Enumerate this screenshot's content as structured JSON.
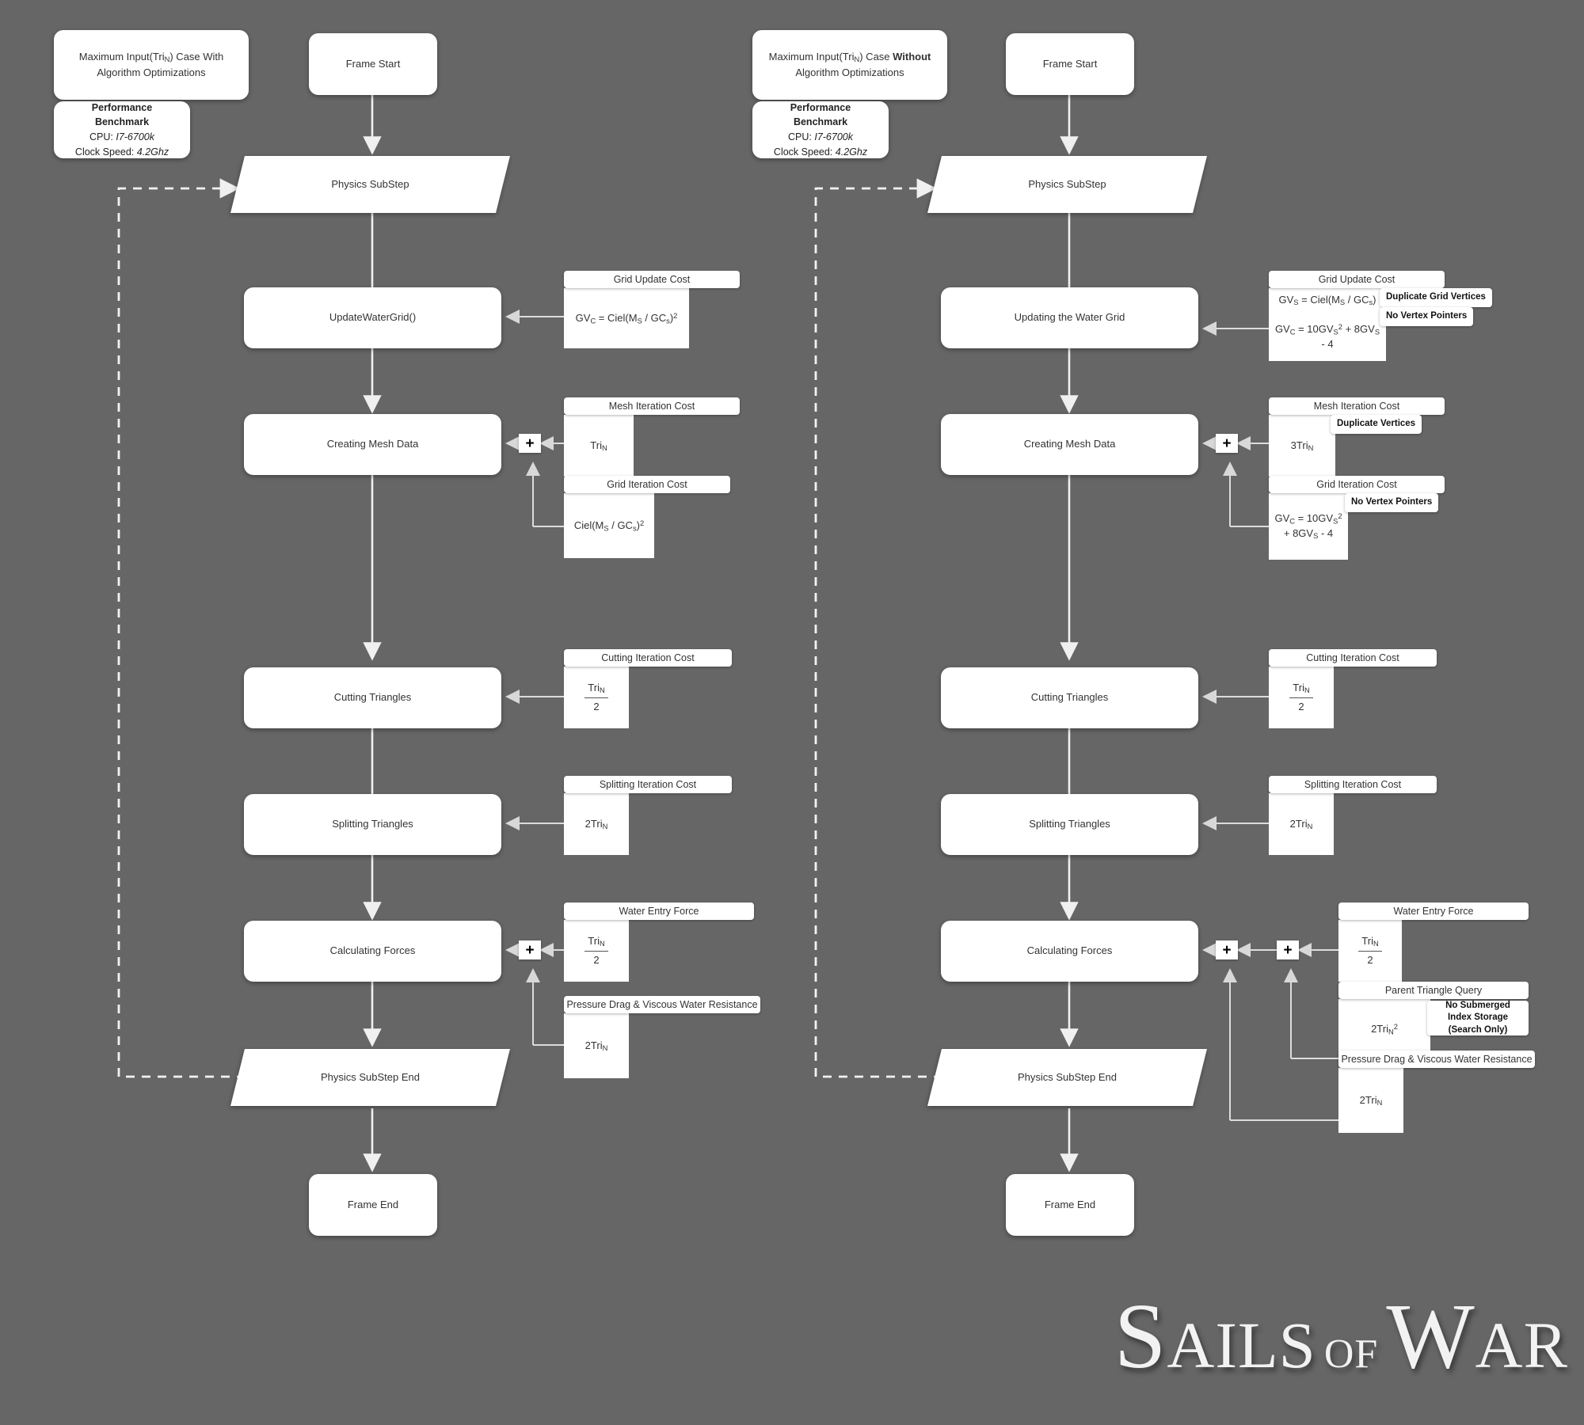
{
  "background_color": "#666666",
  "node_color": "#ffffff",
  "text_color": "#333333",
  "logo": {
    "word1": "Sails",
    "word2": "of",
    "word3": "War"
  },
  "columns": [
    {
      "id": "with-optimizations",
      "title": "Maximum Input(Triₙ) Case With Algorithm Optimizations",
      "title_html": "Maximum Input(Tri<sub>N</sub>) Case With Algorithm Optimizations",
      "benchmark": {
        "heading": "Performance Benchmark",
        "cpu_label": "CPU:",
        "cpu_value": "I7-6700k",
        "clock_label": "Clock Speed:",
        "clock_value": "4.2Ghz"
      },
      "nodes": {
        "frame_start": "Frame Start",
        "physics_substep": "Physics SubStep",
        "update_grid": "UpdateWaterGrid()",
        "creating_mesh": "Creating Mesh Data",
        "cutting": "Cutting Triangles",
        "splitting": "Splitting Triangles",
        "forces": "Calculating Forces",
        "physics_substep_end": "Physics SubStep End",
        "frame_end": "Frame End"
      },
      "costs": [
        {
          "id": "grid-update-cost",
          "header": "Grid Update Cost",
          "body_html": "GV<sub>C</sub> = Ciel(M<sub>S</sub> / GC<sub>s</sub>)<sup>2</sup>",
          "body_text": "GVC = Ciel(MS / GCs)2",
          "tags": []
        },
        {
          "id": "mesh-iteration-cost",
          "header": "Mesh Iteration Cost",
          "body_html": "Tri<sub>N</sub>",
          "body_text": "TriN",
          "tags": []
        },
        {
          "id": "grid-iteration-cost",
          "header": "Grid Iteration Cost",
          "body_html": "Ciel(M<sub>S</sub> / GC<sub>s</sub>)<sup>2</sup>",
          "body_text": "Ciel(MS / GCs)2",
          "tags": []
        },
        {
          "id": "cutting-iteration-cost",
          "header": "Cutting Iteration Cost",
          "body_html": "frac:Tri<sub>N</sub>|2",
          "body_text": "TriN / 2",
          "tags": []
        },
        {
          "id": "splitting-iteration-cost",
          "header": "Splitting Iteration Cost",
          "body_html": "2Tri<sub>N</sub>",
          "body_text": "2TriN",
          "tags": []
        },
        {
          "id": "water-entry-force",
          "header": "Water Entry Force",
          "body_html": "frac:Tri<sub>N</sub>|2",
          "body_text": "TriN / 2",
          "tags": []
        },
        {
          "id": "pressure-drag",
          "header": "Pressure Drag & Viscous Water Resistance",
          "body_html": "2Tri<sub>N</sub>",
          "body_text": "2TriN",
          "tags": []
        }
      ]
    },
    {
      "id": "without-optimizations",
      "title": "Maximum Input(Triₙ) Case Without Algorithm Optimizations",
      "title_html": "Maximum Input(Tri<sub>N</sub>) Case <b>Without</b> Algorithm Optimizations",
      "benchmark": {
        "heading": "Performance Benchmark",
        "cpu_label": "CPU:",
        "cpu_value": "I7-6700k",
        "clock_label": "Clock Speed:",
        "clock_value": "4.2Ghz"
      },
      "nodes": {
        "frame_start": "Frame Start",
        "physics_substep": "Physics SubStep",
        "update_grid": "Updating the Water Grid",
        "creating_mesh": "Creating Mesh Data",
        "cutting": "Cutting Triangles",
        "splitting": "Splitting Triangles",
        "forces": "Calculating Forces",
        "physics_substep_end": "Physics SubStep End",
        "frame_end": "Frame End"
      },
      "costs": [
        {
          "id": "grid-update-cost",
          "header": "Grid Update Cost",
          "body_html": "GV<sub>S</sub> = Ciel(M<sub>S</sub> / GC<sub>s</sub>)",
          "body2_html": "GV<sub>C</sub> = 10GV<sub>S</sub><sup>2</sup> + 8GV<sub>S</sub> - 4",
          "body_text": "GVS = Ciel(MS / GCs) ; GVC = 10GVS2 + 8GVS - 4",
          "tags": [
            "Duplicate Grid Vertices",
            "No Vertex Pointers"
          ]
        },
        {
          "id": "mesh-iteration-cost",
          "header": "Mesh Iteration Cost",
          "body_html": "3Tri<sub>N</sub>",
          "body_text": "3TriN",
          "tags": [
            "Duplicate Vertices"
          ]
        },
        {
          "id": "grid-iteration-cost",
          "header": "Grid Iteration Cost",
          "body_html": "GV<sub>C</sub> = 10GV<sub>S</sub><sup>2</sup> + 8GV<sub>S</sub> - 4",
          "body_text": "GVC = 10GVS2 + 8GVS - 4",
          "tags": [
            "No Vertex Pointers"
          ]
        },
        {
          "id": "cutting-iteration-cost",
          "header": "Cutting Iteration Cost",
          "body_html": "frac:Tri<sub>N</sub>|2",
          "body_text": "TriN / 2",
          "tags": []
        },
        {
          "id": "splitting-iteration-cost",
          "header": "Splitting Iteration Cost",
          "body_html": "2Tri<sub>N</sub>",
          "body_text": "2TriN",
          "tags": []
        },
        {
          "id": "water-entry-force",
          "header": "Water Entry Force",
          "body_html": "frac:Tri<sub>N</sub>|2",
          "body_text": "TriN / 2",
          "tags": []
        },
        {
          "id": "parent-triangle-query",
          "header": "Parent Triangle Query",
          "body_html": "2Tri<sub>N</sub><sup>2</sup>",
          "body_text": "2TriN2",
          "tags": [
            "No Submerged Index Storage (Search Only)"
          ]
        },
        {
          "id": "pressure-drag",
          "header": "Pressure Drag & Viscous Water Resistance",
          "body_html": "2Tri<sub>N</sub>",
          "body_text": "2TriN",
          "tags": []
        }
      ]
    }
  ],
  "junction_symbol": "+"
}
